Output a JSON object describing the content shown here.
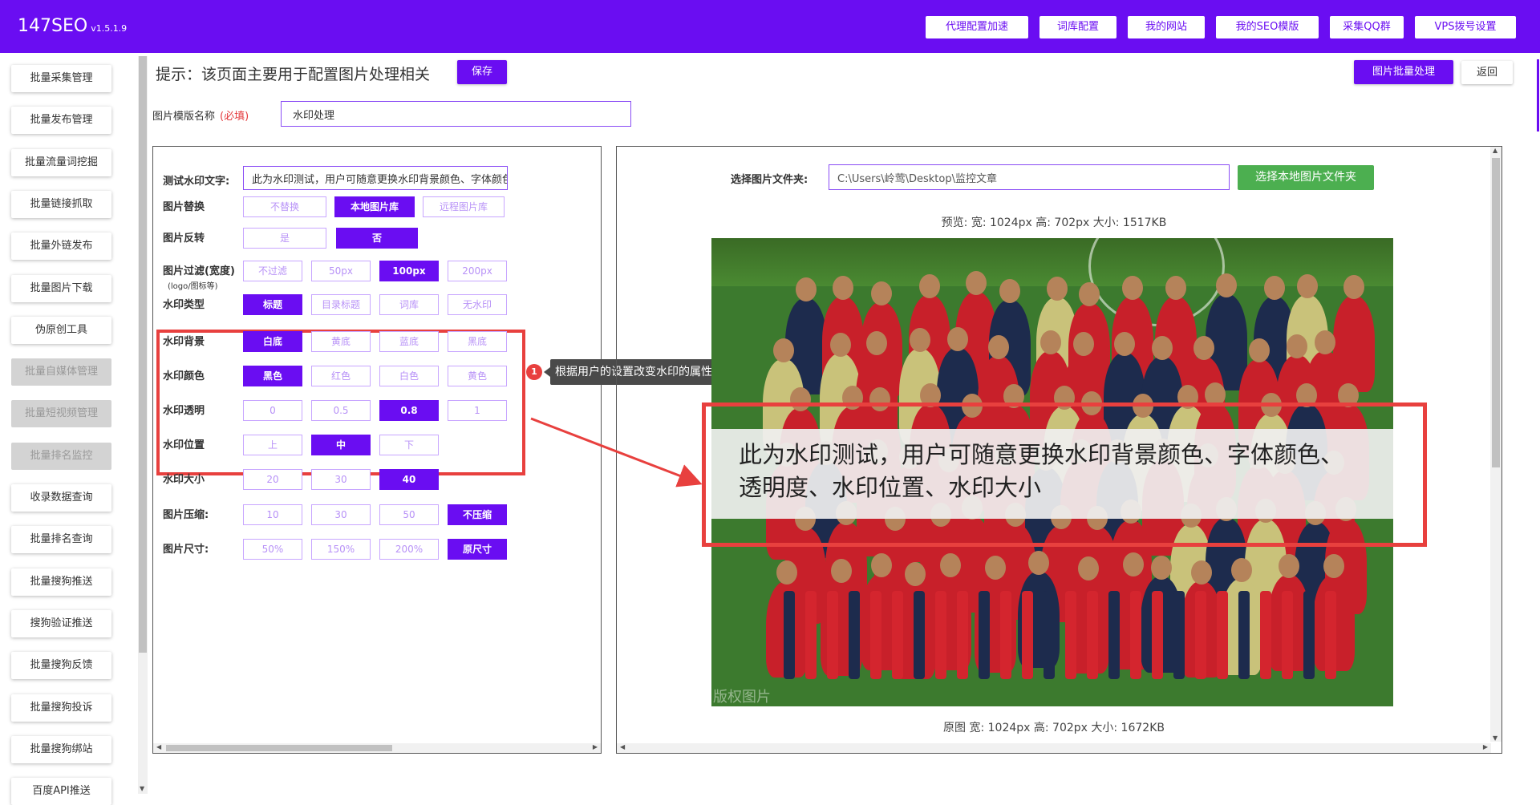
{
  "header": {
    "brand": "147SEO",
    "version": "v1.5.1.9",
    "nav": [
      "代理配置加速",
      "词库配置",
      "我的网站",
      "我的SEO模版",
      "采集QQ群",
      "VPS拨号设置"
    ]
  },
  "sidebar": {
    "items": [
      {
        "label": "批量采集管理",
        "disabled": false
      },
      {
        "label": "批量发布管理",
        "disabled": false
      },
      {
        "label": "批量流量词挖掘",
        "disabled": false
      },
      {
        "label": "批量链接抓取",
        "disabled": false
      },
      {
        "label": "批量外链发布",
        "disabled": false
      },
      {
        "label": "批量图片下载",
        "disabled": false
      },
      {
        "label": "伪原创工具",
        "disabled": false
      },
      {
        "label": "批量自媒体管理",
        "disabled": true
      },
      {
        "label": "批量短视频管理",
        "disabled": true
      },
      {
        "label": "批量排名监控",
        "disabled": true
      },
      {
        "label": "收录数据查询",
        "disabled": false
      },
      {
        "label": "批量排名查询",
        "disabled": false
      },
      {
        "label": "批量搜狗推送",
        "disabled": false
      },
      {
        "label": "搜狗验证推送",
        "disabled": false
      },
      {
        "label": "批量搜狗反馈",
        "disabled": false
      },
      {
        "label": "批量搜狗投诉",
        "disabled": false
      },
      {
        "label": "批量搜狗绑站",
        "disabled": false
      },
      {
        "label": "百度API推送",
        "disabled": false
      }
    ]
  },
  "page": {
    "tip": "提示：该页面主要用于配置图片处理相关",
    "save_label": "保存",
    "batch_label": "图片批量处理",
    "back_label": "返回",
    "template_label": "图片模版名称",
    "required_label": "(必填)",
    "template_value": "水印处理"
  },
  "settings": {
    "watermark_text_label": "测试水印文字:",
    "watermark_text_value": "此为水印测试，用户可随意更换水印背景颜色、字体颜色、透明度、水印位置、水印大小",
    "rows": [
      {
        "label": "图片替换",
        "options": [
          "不替换",
          "本地图片库",
          "远程图片库"
        ],
        "selected": 1
      },
      {
        "label": "图片反转",
        "options": [
          "是",
          "否"
        ],
        "selected": 1
      },
      {
        "label": "图片过滤(宽度)",
        "sublabel": "(logo/图标等)",
        "options": [
          "不过滤",
          "50px",
          "100px",
          "200px"
        ],
        "selected": 2
      },
      {
        "label": "水印类型",
        "options": [
          "标题",
          "目录标题",
          "词库",
          "无水印"
        ],
        "selected": 0
      },
      {
        "label": "水印背景",
        "options": [
          "白底",
          "黄底",
          "蓝底",
          "黑底"
        ],
        "selected": 0
      },
      {
        "label": "水印颜色",
        "options": [
          "黑色",
          "红色",
          "白色",
          "黄色"
        ],
        "selected": 0
      },
      {
        "label": "水印透明",
        "options": [
          "0",
          "0.5",
          "0.8",
          "1"
        ],
        "selected": 2
      },
      {
        "label": "水印位置",
        "options": [
          "上",
          "中",
          "下"
        ],
        "selected": 1
      },
      {
        "label": "水印大小",
        "options": [
          "20",
          "30",
          "40"
        ],
        "selected": 2
      },
      {
        "label": "图片压缩:",
        "options": [
          "10",
          "30",
          "50",
          "不压缩"
        ],
        "selected": 3
      },
      {
        "label": "图片尺寸:",
        "options": [
          "50%",
          "150%",
          "200%",
          "原尺寸"
        ],
        "selected": 3
      }
    ]
  },
  "callout": {
    "number": "1",
    "text": "根据用户的设置改变水印的属性"
  },
  "preview": {
    "folder_label": "选择图片文件夹:",
    "folder_value": "C:\\Users\\岭莺\\Desktop\\监控文章",
    "choose_button": "选择本地图片文件夹",
    "preview_info": "预览:  宽: 1024px 高: 702px 大小: 1517KB",
    "watermark_overlay": "此为水印测试，用户可随意更换水印背景颜色、字体颜色、透明度、水印位置、水印大小",
    "photo_copyright": "版权图片",
    "original_info": "原图  宽: 1024px 高: 702px 大小: 1672KB"
  },
  "colors": {
    "brand": "#6a0df2",
    "highlight": "#e8403e",
    "success": "#4caf50"
  }
}
